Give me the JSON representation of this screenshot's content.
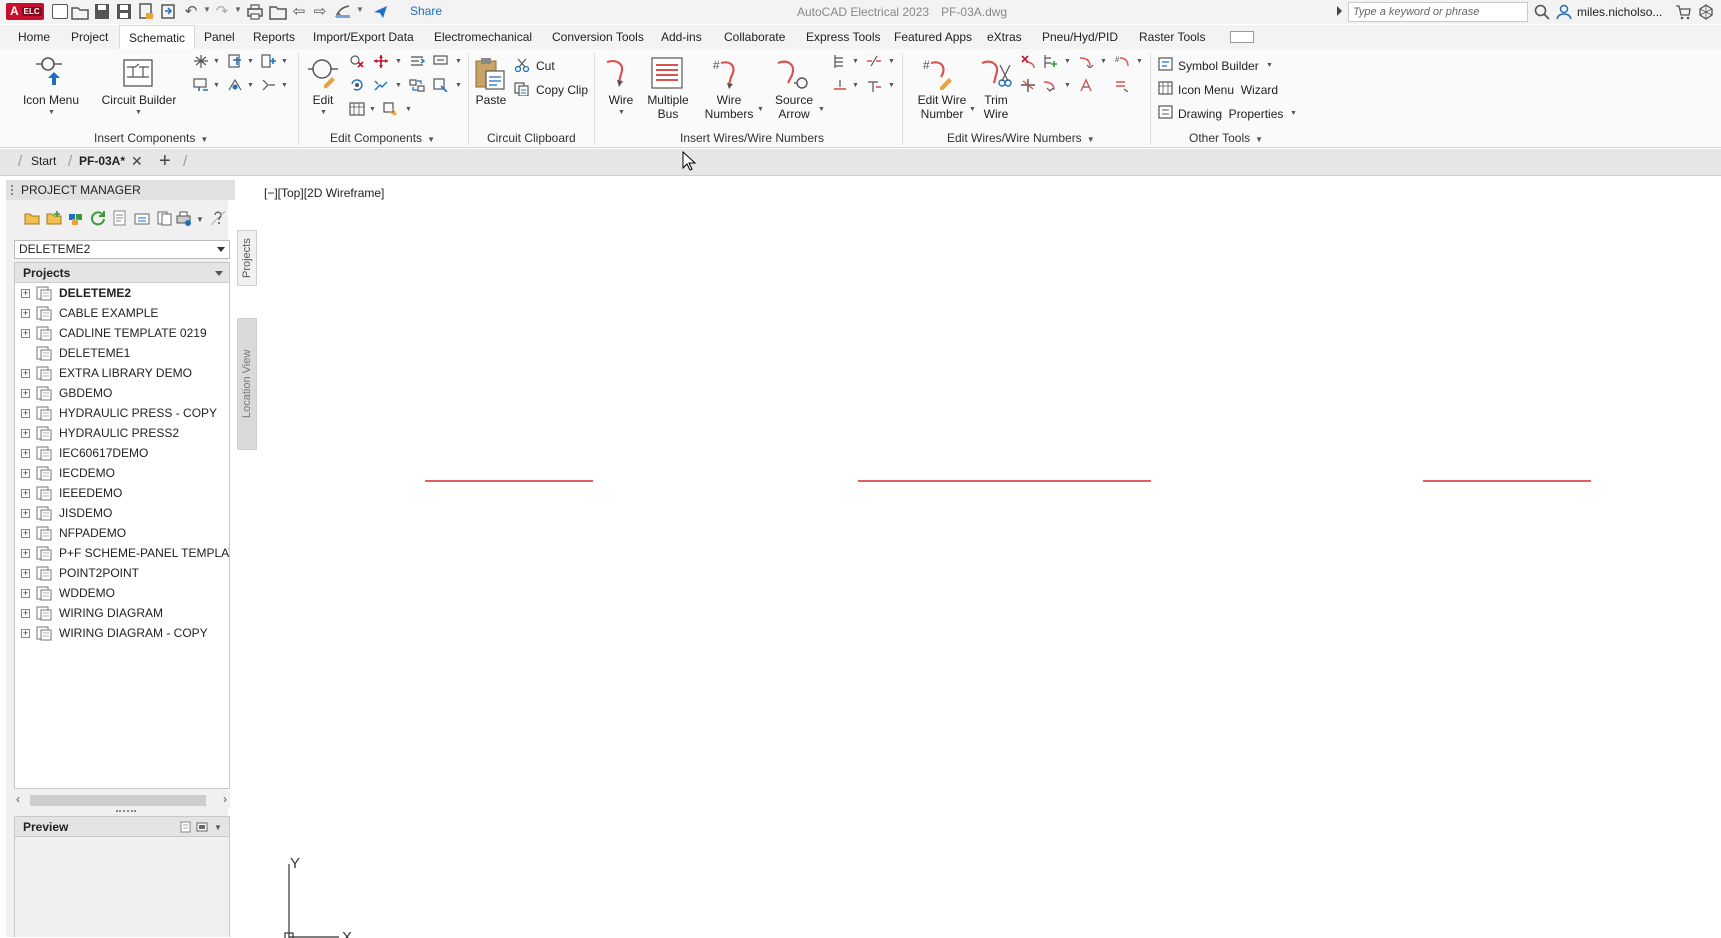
{
  "titlebar": {
    "logo": "A",
    "logo_sub": "ELC",
    "share": "Share",
    "app_name": "AutoCAD Electrical 2023",
    "file_name": "PF-03A.dwg",
    "search_placeholder": "Type a keyword or phrase",
    "user": "miles.nicholso..."
  },
  "ribbon_tabs": [
    "Home",
    "Project",
    "Schematic",
    "Panel",
    "Reports",
    "Import/Export Data",
    "Electromechanical",
    "Conversion Tools",
    "Add-ins",
    "Collaborate",
    "Express Tools",
    "Featured Apps",
    "eXtras",
    "Pneu/Hyd/PID",
    "Raster Tools"
  ],
  "ribbon_active_tab": "Schematic",
  "ribbon": {
    "insert_components": {
      "title": "Insert Components",
      "icon_menu": "Icon Menu",
      "circuit_builder": "Circuit Builder"
    },
    "edit_components": {
      "title": "Edit Components",
      "edit": "Edit"
    },
    "circuit_clipboard": {
      "title": "Circuit Clipboard",
      "paste": "Paste",
      "cut": "Cut",
      "copy_clip": "Copy Clip"
    },
    "insert_wires": {
      "title": "Insert Wires/Wire Numbers",
      "wire": "Wire",
      "multiple_bus_1": "Multiple",
      "multiple_bus_2": "Bus",
      "wire_numbers_1": "Wire",
      "wire_numbers_2": "Numbers",
      "source_arrow_1": "Source",
      "source_arrow_2": "Arrow"
    },
    "edit_wires": {
      "title": "Edit Wires/Wire Numbers",
      "edit_wire_number_1": "Edit Wire",
      "edit_wire_number_2": "Number",
      "trim_wire_1": "Trim",
      "trim_wire_2": "Wire"
    },
    "other_tools": {
      "title": "Other Tools",
      "symbol_builder": "Symbol Builder",
      "icon_menu_wizard": "Icon Menu  Wizard",
      "drawing_properties": "Drawing  Properties"
    }
  },
  "doc_tabs": {
    "start": "Start",
    "active": "PF-03A*"
  },
  "project_manager": {
    "title": "PROJECT MANAGER",
    "selected_project": "DELETEME2",
    "tree_header": "Projects",
    "projects": [
      {
        "name": "DELETEME2",
        "bold": true,
        "expandable": true
      },
      {
        "name": "CABLE EXAMPLE",
        "bold": false,
        "expandable": true
      },
      {
        "name": "CADLINE TEMPLATE 0219",
        "bold": false,
        "expandable": true
      },
      {
        "name": "DELETEME1",
        "bold": false,
        "expandable": false
      },
      {
        "name": "EXTRA LIBRARY DEMO",
        "bold": false,
        "expandable": true
      },
      {
        "name": "GBDEMO",
        "bold": false,
        "expandable": true
      },
      {
        "name": "HYDRAULIC PRESS - COPY",
        "bold": false,
        "expandable": true
      },
      {
        "name": "HYDRAULIC PRESS2",
        "bold": false,
        "expandable": true
      },
      {
        "name": "IEC60617DEMO",
        "bold": false,
        "expandable": true
      },
      {
        "name": "IECDEMO",
        "bold": false,
        "expandable": true
      },
      {
        "name": "IEEEDEMO",
        "bold": false,
        "expandable": true
      },
      {
        "name": "JISDEMO",
        "bold": false,
        "expandable": true
      },
      {
        "name": "NFPADEMO",
        "bold": false,
        "expandable": true
      },
      {
        "name": "P+F SCHEME-PANEL TEMPLATE",
        "bold": false,
        "expandable": true
      },
      {
        "name": "POINT2POINT",
        "bold": false,
        "expandable": true
      },
      {
        "name": "WDDEMO",
        "bold": false,
        "expandable": true
      },
      {
        "name": "WIRING DIAGRAM",
        "bold": false,
        "expandable": true
      },
      {
        "name": "WIRING DIAGRAM - COPY",
        "bold": false,
        "expandable": true
      }
    ],
    "preview": "Preview"
  },
  "side_tabs": {
    "projects": "Projects",
    "location_view": "Location View"
  },
  "canvas": {
    "viewport_label": "[−][Top][2D Wireframe]",
    "ucs_y": "Y",
    "ucs_x": "X",
    "wire_color": "#e06060"
  },
  "colors": {
    "accent": "#1c6fc2",
    "logo": "#c8102e"
  }
}
